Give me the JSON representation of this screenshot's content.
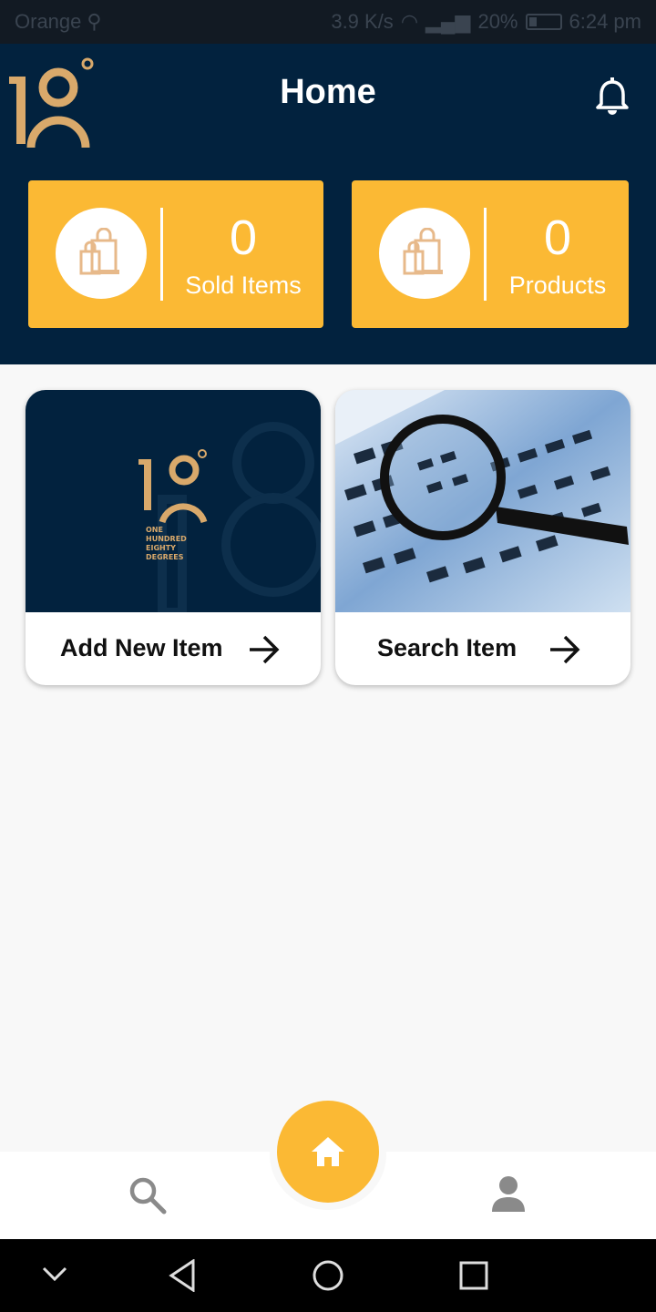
{
  "status_bar": {
    "carrier": "Orange",
    "speed": "3.9 K/s",
    "battery": "20%",
    "time": "6:24 pm"
  },
  "header": {
    "title": "Home",
    "logo_icon": "180-degrees-logo",
    "notification_icon": "bell-icon"
  },
  "stats": [
    {
      "value": "0",
      "label": "Sold Items",
      "icon": "shopping-bags-icon"
    },
    {
      "value": "0",
      "label": "Products",
      "icon": "shopping-bags-icon"
    }
  ],
  "actions": [
    {
      "label": "Add New Item",
      "image": "brand-logo-card",
      "logo_text": [
        "ONE",
        "HUNDRED",
        "EIGHTY",
        "DEGREES"
      ]
    },
    {
      "label": "Search Item",
      "image": "magnifier-on-keyboard"
    }
  ],
  "bottom_nav": {
    "items": [
      "search-icon",
      "home-icon",
      "profile-icon"
    ]
  },
  "colors": {
    "navy": "#02223e",
    "accent": "#fbb934",
    "logo_gold": "#d9a96b"
  }
}
